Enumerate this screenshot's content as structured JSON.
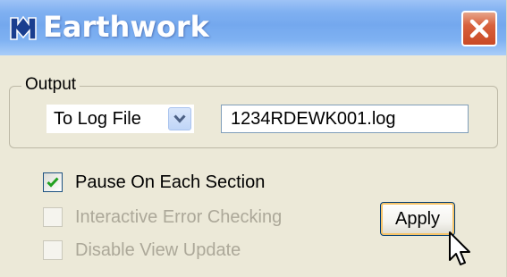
{
  "window": {
    "title": "Earthwork",
    "close_icon": "close-icon",
    "app_icon": "earthwork-app-icon",
    "colors": {
      "titlebar": "#7fb0f1",
      "close_button": "#d8613d",
      "dialog_bg": "#ece9d8"
    }
  },
  "output_group": {
    "label": "Output",
    "destination_select": {
      "value": "To Log File",
      "arrow_icon": "chevron-down-icon"
    },
    "log_file_field": {
      "value": "1234RDEWK001.log"
    }
  },
  "options": [
    {
      "label": "Pause On Each Section",
      "checked": true,
      "enabled": true
    },
    {
      "label": "Interactive Error Checking",
      "checked": false,
      "enabled": false
    },
    {
      "label": "Disable View Update",
      "checked": false,
      "enabled": false
    }
  ],
  "apply_button": {
    "label": "Apply"
  },
  "cursor_icon": "mouse-pointer-icon"
}
